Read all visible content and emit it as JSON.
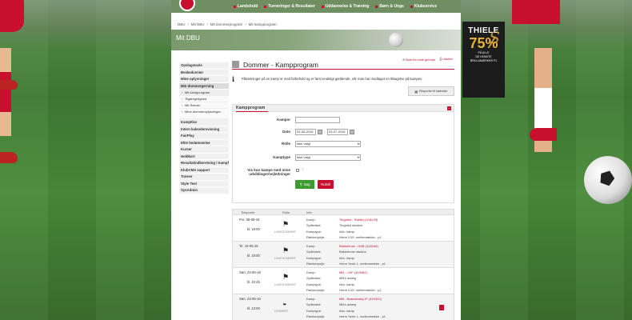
{
  "nav": {
    "items": [
      {
        "label": "Landshold"
      },
      {
        "label": "Turneringer & Resultater"
      },
      {
        "label": "Uddannelse & Træning"
      },
      {
        "label": "Børn & Unge"
      },
      {
        "label": "Klubservice"
      }
    ]
  },
  "breadcrumb": [
    "DBU",
    "Mit DBU",
    "Mit dommerprogram",
    "Mit kampprogram"
  ],
  "banner": {
    "title": "Mit DBU"
  },
  "advert": {
    "brand": "THIELE",
    "pct": "75%",
    "lines": [
      "PÅ ALLE",
      "DE KENDTE",
      "BRILLAMÆRKER P1"
    ]
  },
  "sidebar": {
    "items": [
      {
        "label": "Opslagstavle",
        "type": "item"
      },
      {
        "label": "Beskedcenter",
        "type": "item"
      },
      {
        "label": "Mine oplysninger",
        "type": "item"
      },
      {
        "label": "Min dommergerning",
        "type": "item",
        "active": true
      },
      {
        "label": "Mit kampprogram",
        "type": "sub",
        "active": true
      },
      {
        "label": "Tilgængelighed",
        "type": "sub"
      },
      {
        "label": "Mit Rævler",
        "type": "sub"
      },
      {
        "label": "Mine dommeroplysninger",
        "type": "sub",
        "tall": true
      },
      {
        "label": "KampKlar",
        "type": "item"
      },
      {
        "label": "Intern kalenderevisning",
        "type": "item"
      },
      {
        "label": "FairPlay",
        "type": "item"
      },
      {
        "label": "Elite bedømmelse",
        "type": "item"
      },
      {
        "label": "Kurser",
        "type": "item"
      },
      {
        "label": "Holdkort",
        "type": "item"
      },
      {
        "label": "Resultatindberetning / Kampfakta",
        "type": "item"
      },
      {
        "label": "KlubCMS support",
        "type": "item"
      },
      {
        "label": "Træner",
        "type": "item"
      },
      {
        "label": "Style Test",
        "type": "item"
      },
      {
        "label": "SysAdmin",
        "type": "item"
      }
    ]
  },
  "content": {
    "title": "Dommer - Kampprogram",
    "links": {
      "bookmark": "Bare fra mine genveje",
      "print": "Udskriv"
    },
    "info": "Påsætninger på en kamp er med forbehold og er først endeligt gældende, når man har modtaget en tilsagelse på kampen.",
    "export": "Eksporter til kalender"
  },
  "filter": {
    "title": "Kampprogram",
    "collapse": "−",
    "kampnr_label": "Kampnr",
    "kampnr_value": "",
    "dato_label": "Dato",
    "date_from": "02-05-2016",
    "date_sep": "-",
    "date_to": "03-07-2016",
    "rolle_label": "Rolle",
    "rolle_value": "Ikke valgt",
    "kamptype_label": "Kamptype",
    "kamptype_value": "Ikke valgt",
    "checkbox_label_1": "Vis kun kampe med mine",
    "checkbox_label_2": "udviklinger/vejledninger",
    "help": "?",
    "search_button": "Søg",
    "reset_button": "Nulstil"
  },
  "results": {
    "headers": [
      "Tidspunkt",
      "Rolle",
      "Info"
    ],
    "keys": [
      "Kamp:",
      "Spillested:",
      "Kamptype:",
      "Række/pulje:"
    ],
    "rows": [
      {
        "date": "Fre. 06-05-16",
        "time": "kl. 19:00",
        "role": "LINIEDOMMER",
        "kamp": "Tingsted - Raldby (418139)",
        "spillested": "Tingsted stadion",
        "kamptype": "Alm. kamp",
        "pulje": "Herre U15, mellemrække - p1"
      },
      {
        "date": "Tir. 10-05-16",
        "time": "kl. 19:00",
        "role": "LINIEDOMMER",
        "kamp": "Bakkehuse - HAB (418168)",
        "spillested": "Bakkehuse stadion",
        "kamptype": "Alm. kamp",
        "pulje": "Herre Serie 1, mellemrække - p1"
      },
      {
        "date": "Søn. 22-05-16",
        "time": "kl. 10:45",
        "role": "LINIEDOMMER",
        "kamp": "MB - LVIF (419082)",
        "spillested": "MB's anlæg",
        "kamptype": "Alm. kamp",
        "pulje": "Herre U15, mellemrække - p1"
      },
      {
        "date": "Søn. 22-05-16",
        "time": "kl. 13:00",
        "role": "DOMMER",
        "kamp": "MB - Brøndersley IF (419202)",
        "spillested": "MB's anlæg",
        "kamptype": "Alm. kamp",
        "pulje": "Herre Serie 1, mellemrække - p1"
      }
    ]
  },
  "colors": {
    "accent": "#c8102e",
    "nav": "#6f8f62",
    "search": "#3c9a2e"
  }
}
